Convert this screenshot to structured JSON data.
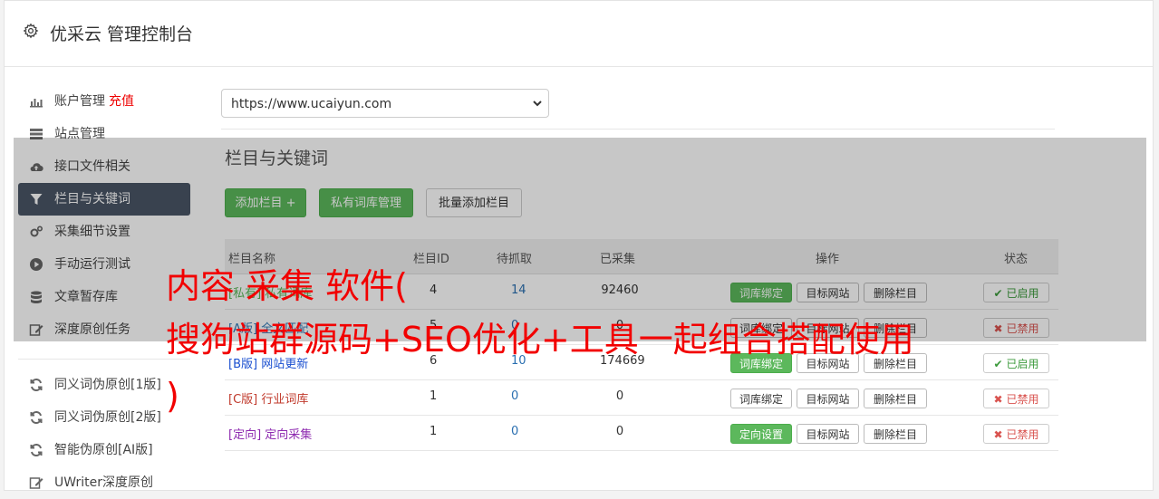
{
  "header": {
    "title": "优采云 管理控制台",
    "icon": "gear-icon"
  },
  "sidebar": {
    "items": [
      {
        "label": "账户管理",
        "extra": "充值",
        "icon": "bar-chart-icon"
      },
      {
        "label": "站点管理",
        "icon": "server-icon"
      },
      {
        "label": "接口文件相关",
        "icon": "cloud-upload-icon"
      },
      {
        "label": "栏目与关键词",
        "icon": "filter-icon",
        "active": true
      },
      {
        "label": "采集细节设置",
        "icon": "gears-icon"
      },
      {
        "label": "手动运行测试",
        "icon": "play-circle-icon"
      },
      {
        "label": "文章暂存库",
        "icon": "database-icon"
      },
      {
        "label": "深度原创任务",
        "icon": "edit-icon"
      }
    ],
    "tools": [
      {
        "label": "同义词伪原创[1版]",
        "icon": "refresh-icon"
      },
      {
        "label": "同义词伪原创[2版]",
        "icon": "refresh-icon"
      },
      {
        "label": "智能伪原创[AI版]",
        "icon": "refresh-icon"
      },
      {
        "label": "UWriter深度原创",
        "icon": "edit-icon"
      }
    ]
  },
  "site_select": {
    "value": "https://www.ucaiyun.com"
  },
  "section": {
    "title": "栏目与关键词"
  },
  "actions": {
    "add": "添加栏目 +",
    "lexicon": "私有词库管理",
    "batch": "批量添加栏目"
  },
  "table": {
    "headers": [
      "栏目名称",
      "栏目ID",
      "待抓取",
      "已采集",
      "操作",
      "状态"
    ],
    "rows": [
      {
        "tag": "[私有]",
        "name": "私有词库",
        "tag_color": "#5cb85c",
        "id": "4",
        "pending": "14",
        "collected": "92460",
        "op1": "词库绑定",
        "op1_style": "green",
        "op2": "目标网站",
        "op3": "删除栏目",
        "status": "已启用",
        "status_type": "ok"
      },
      {
        "tag": "[A版]",
        "name": "全文匹配",
        "tag_color": "#337ab7",
        "id": "5",
        "pending": "0",
        "collected": "0",
        "op1": "词库绑定",
        "op1_style": "white",
        "op2": "目标网站",
        "op3": "删除栏目",
        "status": "已禁用",
        "status_type": "no"
      },
      {
        "tag": "[B版]",
        "name": "网站更新",
        "tag_color": "#1a4fd0",
        "id": "6",
        "pending": "10",
        "collected": "174669",
        "op1": "词库绑定",
        "op1_style": "green",
        "op2": "目标网站",
        "op3": "删除栏目",
        "status": "已启用",
        "status_type": "ok"
      },
      {
        "tag": "[C版]",
        "name": "行业词库",
        "tag_color": "#c0392b",
        "id": "1",
        "pending": "0",
        "collected": "0",
        "op1": "词库绑定",
        "op1_style": "white",
        "op2": "目标网站",
        "op3": "删除栏目",
        "status": "已禁用",
        "status_type": "no"
      },
      {
        "tag": "[定向]",
        "name": "定向采集",
        "tag_color": "#8e2bb0",
        "id": "1",
        "pending": "0",
        "collected": "0",
        "op1": "定向设置",
        "op1_style": "green",
        "op2": "目标网站",
        "op3": "删除栏目",
        "status": "已禁用",
        "status_type": "no"
      }
    ]
  },
  "watermark": {
    "line1": "内容 采集 软件(",
    "line2": "搜狗站群源码+SEO优化+工具一起组合搭配使用",
    "line3": ")"
  },
  "colors": {
    "active_bg": "#4a5566",
    "green": "#5cb85c",
    "watermark": "#f20000"
  }
}
